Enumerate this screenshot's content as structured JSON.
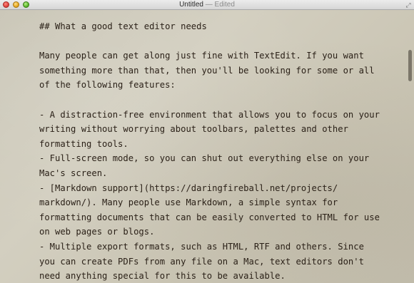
{
  "window": {
    "title": "Untitled",
    "separator": "—",
    "status": "Edited",
    "fullscreen_glyph": "⤢"
  },
  "document": {
    "lines": [
      "## What a good text editor needs",
      "",
      "Many people can get along just fine with TextEdit. If you want",
      "something more than that, then you'll be looking for some or all",
      "of the following features:",
      "",
      "- A distraction-free environment that allows you to focus on your",
      "writing without worrying about toolbars, palettes and other",
      "formatting tools.",
      "- Full-screen mode, so you can shut out everything else on your",
      "Mac's screen.",
      "- [Markdown support](https://daringfireball.net/projects/",
      "markdown/). Many people use Markdown, a simple syntax for",
      "formatting documents that can be easily converted to HTML for use",
      "on web pages or blogs.",
      "- Multiple export formats, such as HTML, RTF and others. Since",
      "you can create PDFs from any file on a Mac, text editors don't",
      "need anything special for this to be available."
    ]
  }
}
